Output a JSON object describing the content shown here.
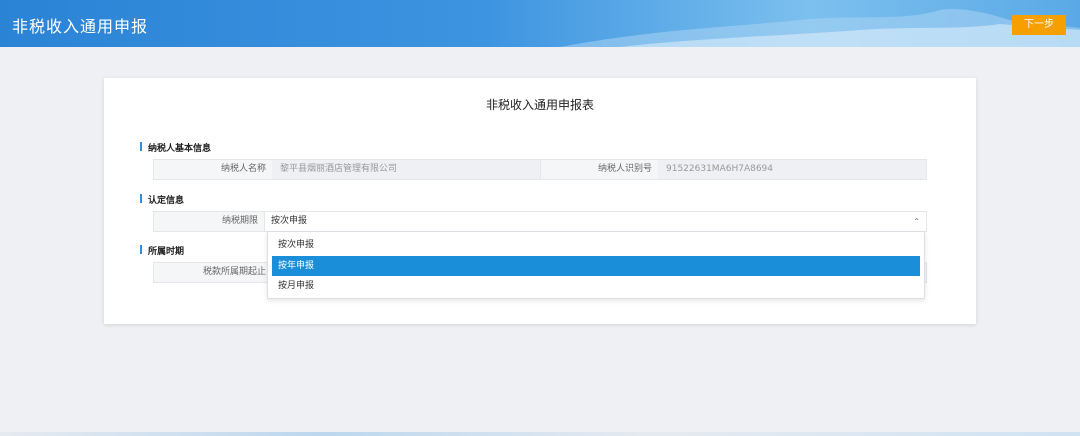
{
  "header": {
    "title": "非税收入通用申报",
    "next_button": "下一步"
  },
  "form": {
    "title": "非税收入通用申报表",
    "sections": {
      "taxpayer": "纳税人基本信息",
      "recognition": "认定信息",
      "period": "所属时期"
    },
    "taxpayer_name_label": "纳税人名称",
    "taxpayer_name_value": "黎平县烟丽酒店管理有限公司",
    "taxpayer_id_label": "纳税人识别号",
    "taxpayer_id_value": "91522631MA6H7A8694",
    "tax_term_label": "纳税期限",
    "tax_term_value": "按次申报",
    "period_start_label": "税款所属期起止"
  },
  "dropdown": {
    "options": [
      "按次申报",
      "按年申报",
      "按月申报"
    ],
    "selected_index": 1
  },
  "colors": {
    "header_blue": "#2b83d6",
    "next_button": "#f5a000",
    "selected_option": "#1a8ed8",
    "section_marker": "#2d8ce0"
  }
}
